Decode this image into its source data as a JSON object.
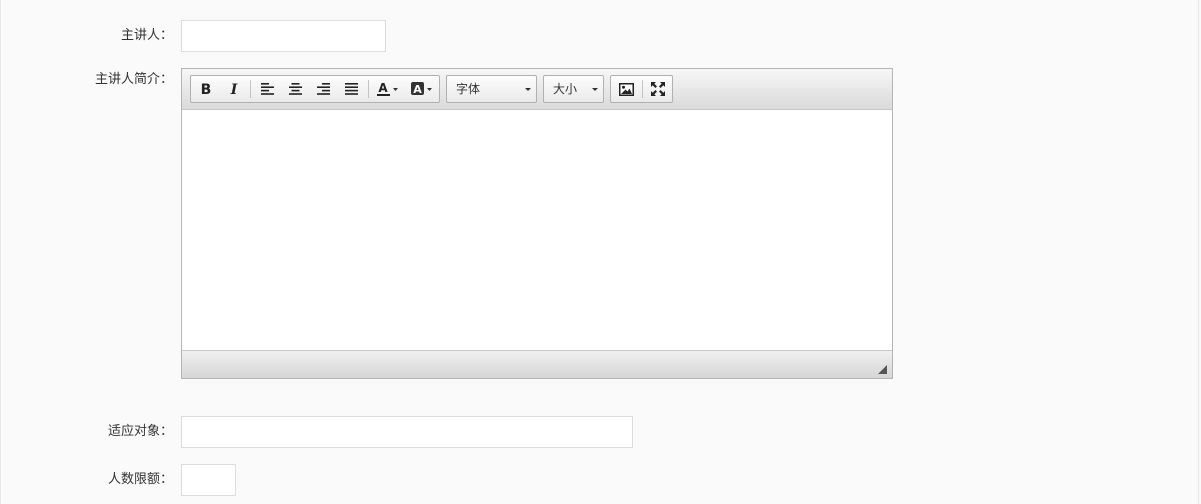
{
  "form": {
    "speaker": {
      "label": "主讲人：",
      "value": ""
    },
    "speaker_intro": {
      "label": "主讲人简介："
    },
    "audience": {
      "label": "适应对象：",
      "value": ""
    },
    "limit": {
      "label": "人数限额：",
      "value": ""
    }
  },
  "editor": {
    "font_select": "字体",
    "size_select": "大小",
    "icons": [
      "bold-icon",
      "italic-icon",
      "align-left-icon",
      "align-center-icon",
      "align-right-icon",
      "align-justify-icon",
      "font-color-icon",
      "highlight-color-icon",
      "image-icon",
      "fullscreen-icon"
    ],
    "body_text": ""
  }
}
